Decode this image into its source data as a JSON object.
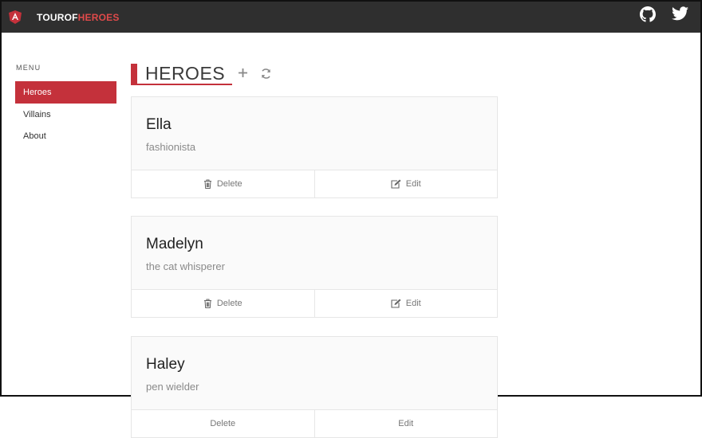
{
  "header": {
    "brand_part1": "TOUR",
    "brand_part2": "OF",
    "brand_part3": "HEROES",
    "icons": [
      "shield-logo-icon",
      "github-icon",
      "twitter-icon"
    ]
  },
  "sidebar": {
    "menu_label": "MENU",
    "items": [
      {
        "label": "Heroes",
        "active": true
      },
      {
        "label": "Villains",
        "active": false
      },
      {
        "label": "About",
        "active": false
      }
    ]
  },
  "main": {
    "title": "HEROES",
    "add_icon": "plus-icon",
    "refresh_icon": "refresh-icon"
  },
  "heroes": [
    {
      "name": "Ella",
      "description": "fashionista",
      "delete_label": "Delete",
      "edit_label": "Edit"
    },
    {
      "name": "Madelyn",
      "description": "the cat whisperer",
      "delete_label": "Delete",
      "edit_label": "Edit"
    },
    {
      "name": "Haley",
      "description": "pen wielder",
      "delete_label": "Delete",
      "edit_label": "Edit"
    }
  ],
  "colors": {
    "accent": "#c4313b",
    "topbar": "#2f2f2f"
  }
}
